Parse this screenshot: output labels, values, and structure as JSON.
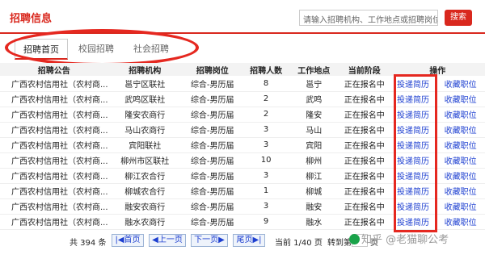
{
  "header": {
    "title": "招聘信息",
    "search_placeholder": "请输入招聘机构、工作地点或招聘岗位",
    "search_button": "搜索"
  },
  "tabs": [
    {
      "label": "招聘首页",
      "active": true
    },
    {
      "label": "校园招聘"
    },
    {
      "label": "社会招聘"
    }
  ],
  "table": {
    "headers": [
      "招聘公告",
      "招聘机构",
      "招聘岗位",
      "招聘人数",
      "工作地点",
      "当前阶段",
      "操作"
    ],
    "rows": [
      {
        "notice": "广西农村信用社（农村商...",
        "org": "邕宁区联社",
        "post": "综合-男历届",
        "count": "8",
        "place": "邕宁",
        "stage": "正在报名中",
        "apply": "投递简历",
        "fav": "收藏职位"
      },
      {
        "notice": "广西农村信用社（农村商...",
        "org": "武鸣区联社",
        "post": "综合-男历届",
        "count": "2",
        "place": "武鸣",
        "stage": "正在报名中",
        "apply": "投递简历",
        "fav": "收藏职位"
      },
      {
        "notice": "广西农村信用社（农村商...",
        "org": "隆安农商行",
        "post": "综合-男历届",
        "count": "2",
        "place": "隆安",
        "stage": "正在报名中",
        "apply": "投递简历",
        "fav": "收藏职位"
      },
      {
        "notice": "广西农村信用社（农村商...",
        "org": "马山农商行",
        "post": "综合-男历届",
        "count": "3",
        "place": "马山",
        "stage": "正在报名中",
        "apply": "投递简历",
        "fav": "收藏职位"
      },
      {
        "notice": "广西农村信用社（农村商...",
        "org": "宾阳联社",
        "post": "综合-男历届",
        "count": "3",
        "place": "宾阳",
        "stage": "正在报名中",
        "apply": "投递简历",
        "fav": "收藏职位"
      },
      {
        "notice": "广西农村信用社（农村商...",
        "org": "柳州市区联社",
        "post": "综合-男历届",
        "count": "10",
        "place": "柳州",
        "stage": "正在报名中",
        "apply": "投递简历",
        "fav": "收藏职位"
      },
      {
        "notice": "广西农村信用社（农村商...",
        "org": "柳江农合行",
        "post": "综合-男历届",
        "count": "3",
        "place": "柳江",
        "stage": "正在报名中",
        "apply": "投递简历",
        "fav": "收藏职位"
      },
      {
        "notice": "广西农村信用社（农村商...",
        "org": "柳城农合行",
        "post": "综合-男历届",
        "count": "1",
        "place": "柳城",
        "stage": "正在报名中",
        "apply": "投递简历",
        "fav": "收藏职位"
      },
      {
        "notice": "广西农村信用社（农村商...",
        "org": "融安农商行",
        "post": "综合-男历届",
        "count": "3",
        "place": "融安",
        "stage": "正在报名中",
        "apply": "投递简历",
        "fav": "收藏职位"
      },
      {
        "notice": "广西农村信用社（农村商...",
        "org": "融水农商行",
        "post": "综合-男历届",
        "count": "9",
        "place": "融水",
        "stage": "正在报名中",
        "apply": "投递简历",
        "fav": "收藏职位"
      }
    ]
  },
  "pager": {
    "total": "共 394 条",
    "first": "首页",
    "prev": "上一页",
    "next": "下一页",
    "last": "尾页",
    "current": "当前 1/40 页",
    "goto": "转到第",
    "page_unit": "页"
  },
  "watermark": "知乎 @老猫聊公考"
}
